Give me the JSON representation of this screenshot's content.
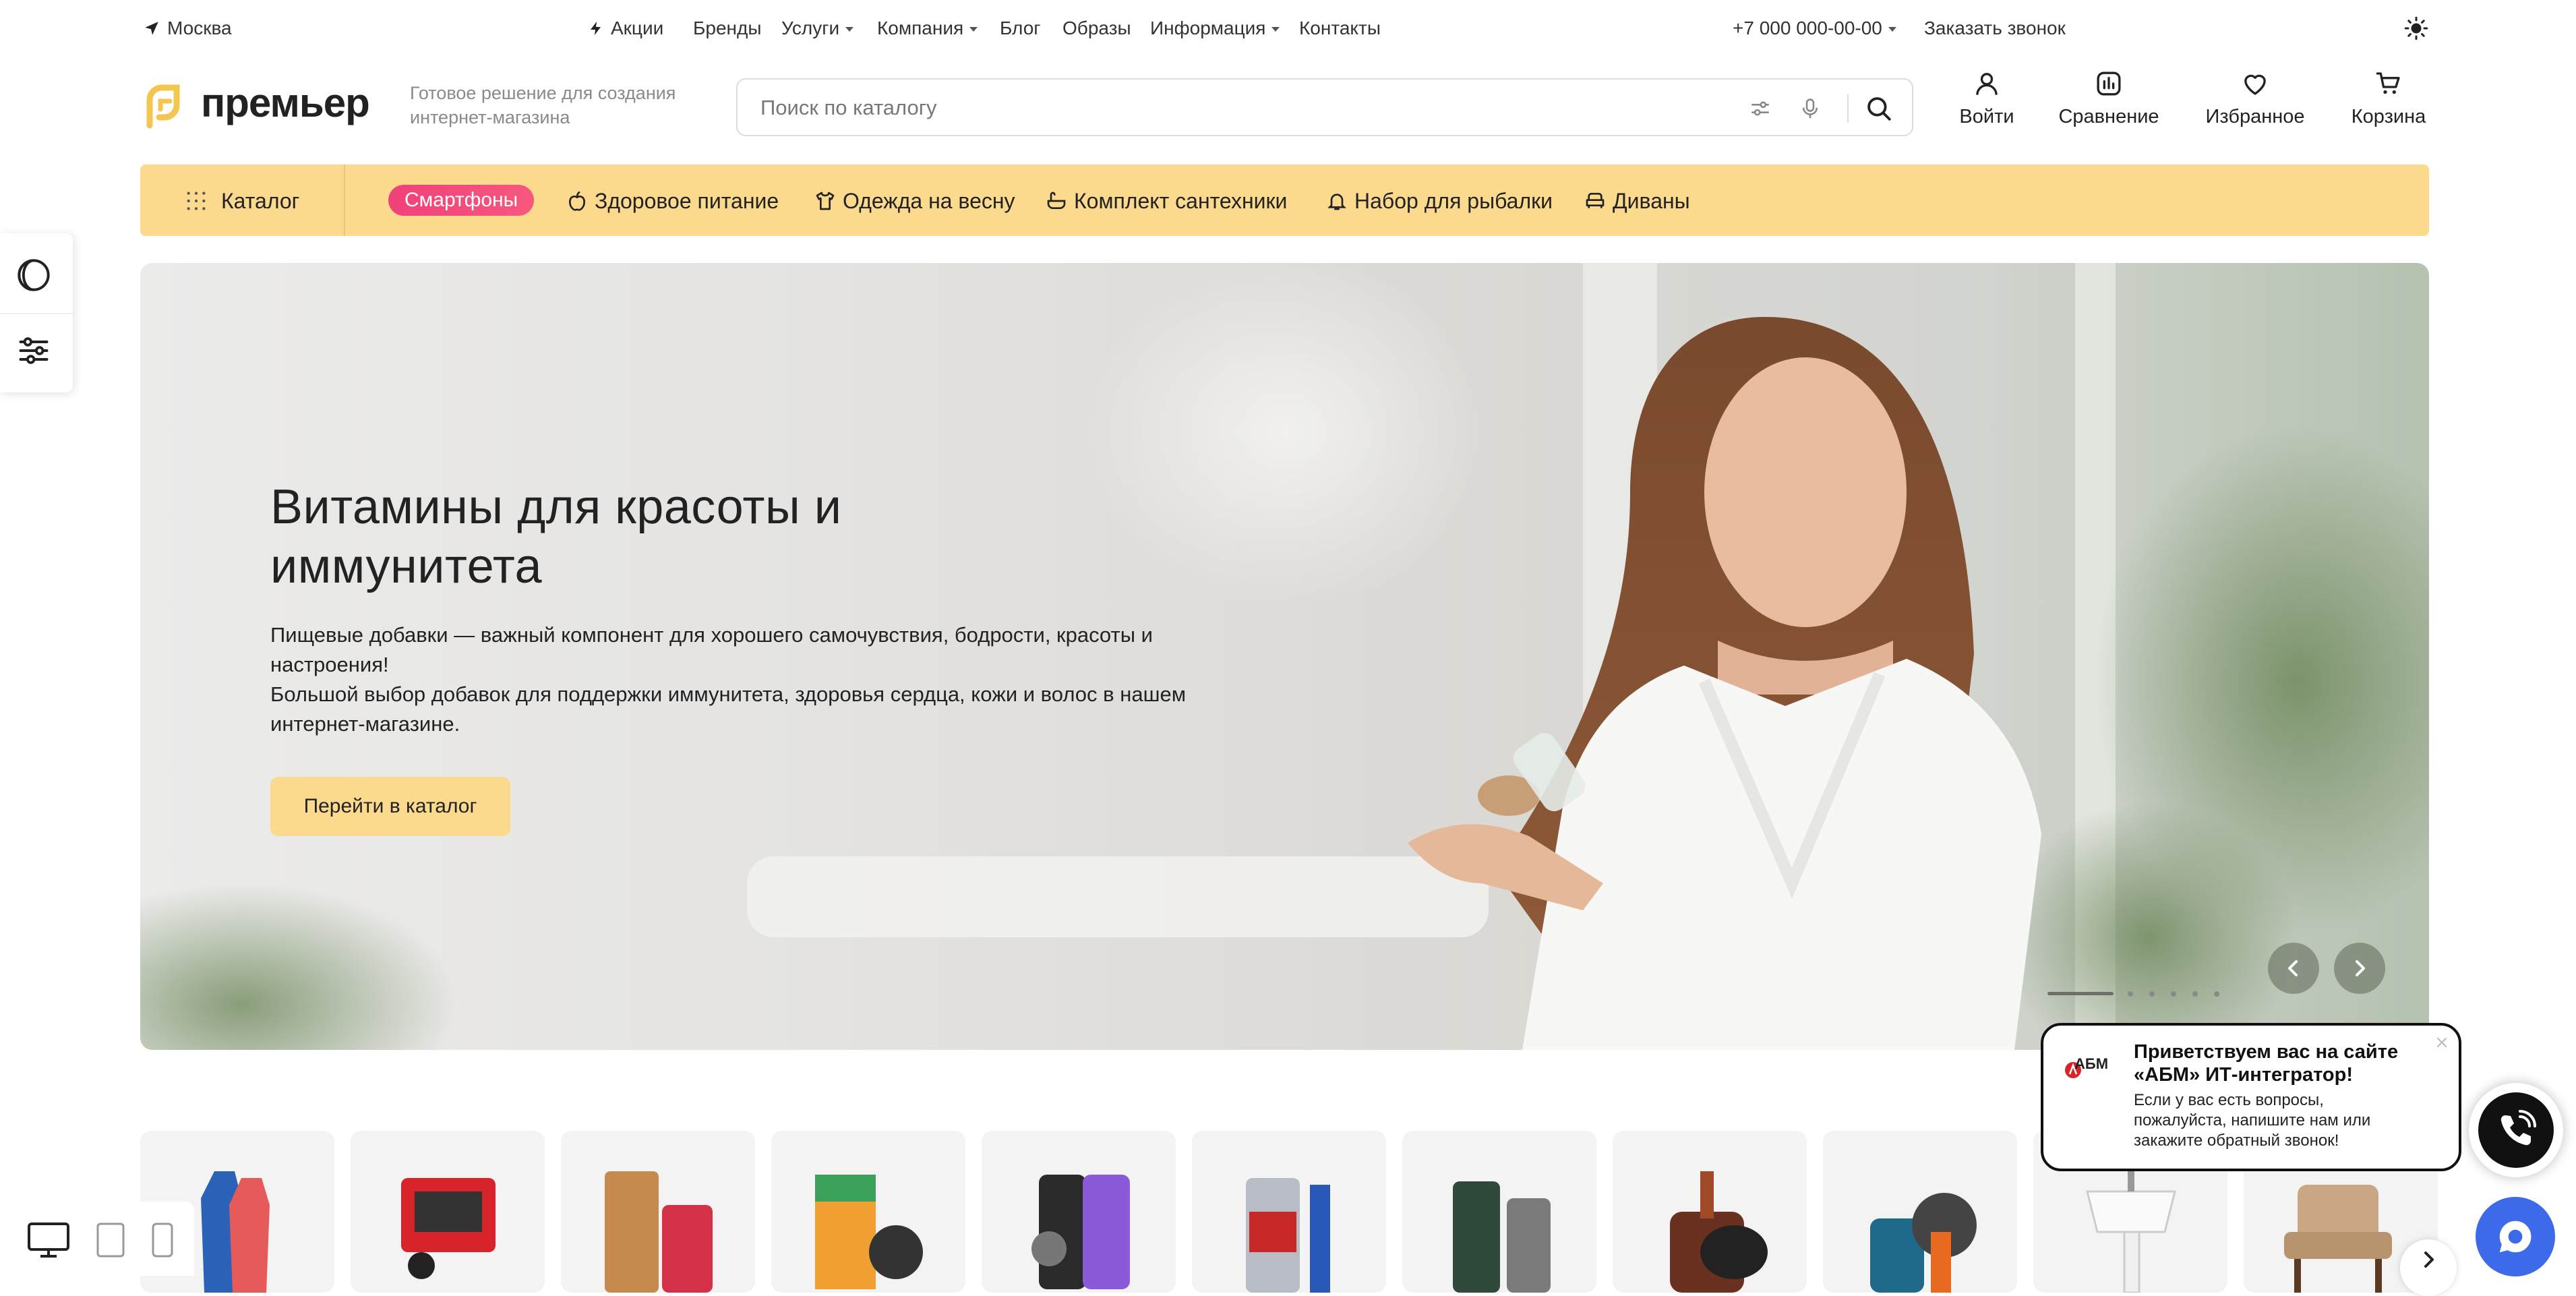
{
  "topbar": {
    "city": "Москва",
    "links": [
      {
        "label": "Акции"
      },
      {
        "label": "Бренды"
      },
      {
        "label": "Услуги"
      },
      {
        "label": "Компания"
      },
      {
        "label": "Блог"
      },
      {
        "label": "Образы"
      },
      {
        "label": "Информация"
      },
      {
        "label": "Контакты"
      }
    ],
    "phone": "+7 000 000-00-00",
    "callback": "Заказать звонок"
  },
  "header": {
    "logo_text": "премьер",
    "tagline": "Готовое решение для создания интернет-магазина",
    "search_placeholder": "Поиск по каталогу",
    "actions": {
      "login": "Войти",
      "compare": "Сравнение",
      "favorites": "Избранное",
      "cart": "Корзина"
    }
  },
  "nav": {
    "catalog": "Каталог",
    "highlight": "Смартфоны",
    "items": [
      {
        "label": "Здоровое питание"
      },
      {
        "label": "Одежда на весну"
      },
      {
        "label": "Комплект сантехники"
      },
      {
        "label": "Набор для рыбалки"
      },
      {
        "label": "Диваны"
      }
    ]
  },
  "banner": {
    "title": "Витамины для красоты и иммунитета",
    "description_1": "Пищевые добавки — важный компонент для хорошего самочувствия, бодрости, красоты и настроения!",
    "description_2": "Большой выбор добавок для поддержки иммунитета, здоровья сердца, кожи и волос в нашем интернет-магазине.",
    "button": "Перейти в каталог",
    "slide_count": 6,
    "active_slide": 1
  },
  "popup": {
    "brand": "АБМ",
    "title": "Приветствуем вас на сайте «АБМ» ИТ-интегратор!",
    "body": "Если у вас есть вопросы, пожалуйста, напишите нам или закажите обратный звонок!"
  },
  "colors": {
    "accent_yellow": "#fbd98d",
    "highlight_pink": "#f0417a",
    "chat_blue": "#3d6ae8"
  }
}
